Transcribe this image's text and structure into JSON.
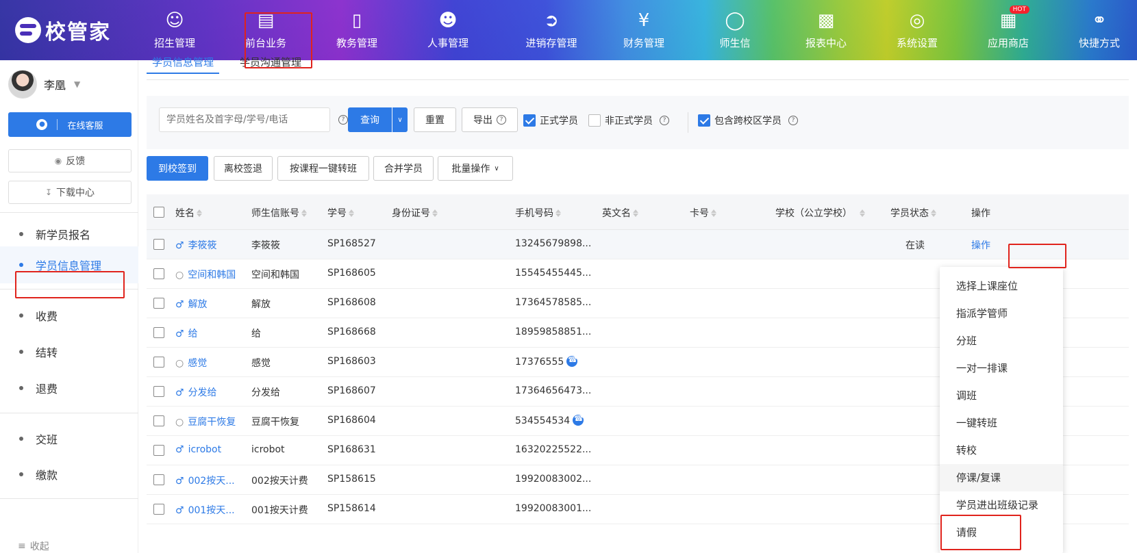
{
  "app": {
    "logo_text": "校管家"
  },
  "nav": [
    {
      "label": "招生管理",
      "icon": "user-add-icon"
    },
    {
      "label": "前台业务",
      "icon": "monitor-icon"
    },
    {
      "label": "教务管理",
      "icon": "book-icon"
    },
    {
      "label": "人事管理",
      "icon": "person-icon"
    },
    {
      "label": "进销存管理",
      "icon": "arrow-box-icon"
    },
    {
      "label": "财务管理",
      "icon": "yen-icon"
    },
    {
      "label": "师生信",
      "icon": "chat-icon"
    },
    {
      "label": "报表中心",
      "icon": "chart-icon"
    },
    {
      "label": "系统设置",
      "icon": "settings-icon"
    },
    {
      "label": "应用商店",
      "icon": "grid-icon",
      "badge": "HOT"
    },
    {
      "label": "快捷方式",
      "icon": "link-icon"
    }
  ],
  "sidebar": {
    "user_name": "李凰",
    "service_label": "在线客服",
    "feedback_label": "反馈",
    "download_label": "下载中心",
    "items": [
      {
        "label": "新学员报名"
      },
      {
        "label": "学员信息管理",
        "active": true
      },
      {
        "label": "收费"
      },
      {
        "label": "结转"
      },
      {
        "label": "退费"
      },
      {
        "label": "交班"
      },
      {
        "label": "缴款"
      }
    ],
    "collapse_label": "收起"
  },
  "tabs": [
    {
      "label": "学员信息管理",
      "active": true
    },
    {
      "label": "学员沟通管理"
    }
  ],
  "filter": {
    "search_placeholder": "学员姓名及首字母/学号/电话",
    "query_label": "查询",
    "reset_label": "重置",
    "export_label": "导出",
    "formal_label": "正式学员",
    "informal_label": "非正式学员",
    "cross_campus_label": "包含跨校区学员"
  },
  "actions": {
    "checkin": "到校签到",
    "checkout": "离校签退",
    "transfer_by_course": "按课程一键转班",
    "merge": "合并学员",
    "batch": "批量操作"
  },
  "table": {
    "columns": [
      "姓名",
      "师生信账号",
      "学号",
      "身份证号",
      "手机号码",
      "英文名",
      "卡号",
      "学校（公立学校）",
      "学员状态",
      "操作"
    ],
    "rows": [
      {
        "gender": "male",
        "name": "李筱筱",
        "account": "李筱筱",
        "id": "SP168527",
        "phone": "13245679898...",
        "status": "在读",
        "op": "操作"
      },
      {
        "gender": "none",
        "name": "空间和韩国",
        "account": "空间和韩国",
        "id": "SP168605",
        "phone": "15545455445..."
      },
      {
        "gender": "male",
        "name": "解放",
        "account": "解放",
        "id": "SP168608",
        "phone": "17364578585..."
      },
      {
        "gender": "male",
        "name": "给",
        "account": "给",
        "id": "SP168668",
        "phone": "18959858851..."
      },
      {
        "gender": "none",
        "name": "感觉",
        "account": "感觉",
        "id": "SP168603",
        "phone": "17376555",
        "call": true
      },
      {
        "gender": "male",
        "name": "分发给",
        "account": "分发给",
        "id": "SP168607",
        "phone": "17364656473..."
      },
      {
        "gender": "none",
        "name": "豆腐干恢复",
        "account": "豆腐干恢复",
        "id": "SP168604",
        "phone": "534554534",
        "call": true
      },
      {
        "gender": "male",
        "name": "icrobot",
        "account": "icrobot",
        "id": "SP168631",
        "phone": "16320225522..."
      },
      {
        "gender": "male",
        "name": "002按天...",
        "account": "002按天计费",
        "id": "SP158615",
        "phone": "19920083002..."
      },
      {
        "gender": "male",
        "name": "001按天...",
        "account": "001按天计费",
        "id": "SP158614",
        "phone": "19920083001..."
      }
    ]
  },
  "dropdown": {
    "items": [
      "选择上课座位",
      "指派学管师",
      "分班",
      "一对一排课",
      "调班",
      "一键转班",
      "转校",
      "停课/复课",
      "学员进出班级记录",
      "请假"
    ],
    "hover_index": 7
  },
  "colors": {
    "primary": "#2d7ae6",
    "highlight_box": "#e0231c"
  }
}
